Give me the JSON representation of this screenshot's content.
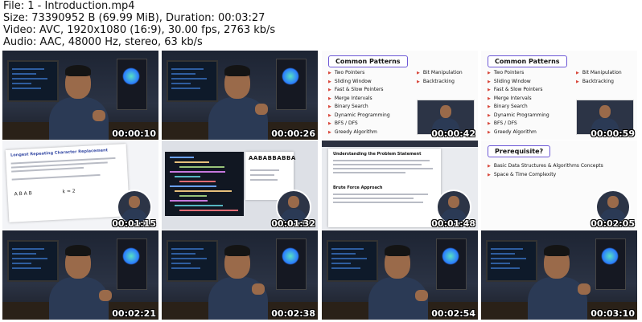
{
  "meta": {
    "file_line": "File: 1 - Introduction.mp4",
    "size_line": "Size: 73390952 B (69.99 MiB), Duration: 00:03:27",
    "video_line": "Video: AVC, 1920x1080 (16:9), 30.00 fps, 2763 kb/s",
    "audio_line": "Audio: AAC, 48000 Hz, stereo, 63 kb/s"
  },
  "thumbnails": [
    {
      "timestamp": "00:00:10",
      "kind": "presenter"
    },
    {
      "timestamp": "00:00:26",
      "kind": "presenter"
    },
    {
      "timestamp": "00:00:42",
      "kind": "patterns"
    },
    {
      "timestamp": "00:00:59",
      "kind": "patterns"
    },
    {
      "timestamp": "00:01:15",
      "kind": "problem"
    },
    {
      "timestamp": "00:01:32",
      "kind": "editor"
    },
    {
      "timestamp": "00:01:48",
      "kind": "statement"
    },
    {
      "timestamp": "00:02:05",
      "kind": "prereq"
    },
    {
      "timestamp": "00:02:21",
      "kind": "presenter"
    },
    {
      "timestamp": "00:02:38",
      "kind": "presenter"
    },
    {
      "timestamp": "00:02:54",
      "kind": "presenter"
    },
    {
      "timestamp": "00:03:10",
      "kind": "presenter"
    }
  ],
  "patterns_slide": {
    "title": "Common Patterns",
    "left_items": [
      "Two Pointers",
      "Sliding Window",
      "Fast & Slow Pointers",
      "Merge Intervals",
      "Binary Search",
      "Dynamic Programming",
      "BFS / DFS",
      "Greedy Algorithm"
    ],
    "right_items": [
      "Bit Manipulation",
      "Backtracking"
    ]
  },
  "problem_slide": {
    "title": "Longest Repeating Character Replacement",
    "sample": "A B A B",
    "k": "k = 2"
  },
  "editor_slide": {
    "string": "AABABBABBA"
  },
  "statement_slide": {
    "title": "Understanding the Problem Statement",
    "subtitle": "Brute Force Approach"
  },
  "prereq_slide": {
    "title": "Prerequisite?",
    "items": [
      "Basic Data Structures & Algorithms Concepts",
      "Space & Time Complexity"
    ]
  }
}
